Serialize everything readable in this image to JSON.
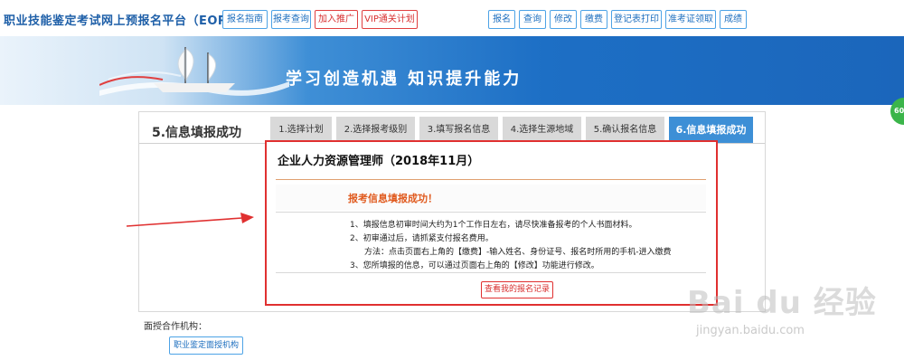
{
  "header": {
    "site_title": "职业技能鉴定考试网上预报名平台（EORS）",
    "left_nav": [
      "报名指南",
      "报考查询",
      "加入推广",
      "VIP通关计划"
    ],
    "right_nav": [
      "报名",
      "查询",
      "修改",
      "缴费",
      "登记表打印",
      "准考证领取",
      "成绩"
    ]
  },
  "banner": {
    "slogan": "学习创造机遇  知识提升能力"
  },
  "main": {
    "page_title": "5.信息填报成功",
    "steps": [
      "1.选择计划",
      "2.选择报考级别",
      "3.填写报名信息",
      "4.选择生源地域",
      "5.确认报名信息",
      "6.信息填报成功"
    ],
    "active_step": 5
  },
  "panel": {
    "cert_title": "企业人力资源管理师（2018年11月）",
    "success_message": "报考信息填报成功！",
    "notes": [
      "1、填报信息初审时间大约为1个工作日左右，请尽快准备报考的个人书面材料。",
      "2、初审通过后，请抓紧支付报名费用。",
      "方法：点击页面右上角的【缴费】-输入姓名、身份证号、报名时所用的手机-进入缴费",
      "3、您所填报的信息，可以通过页面右上角的【修改】功能进行修改。"
    ],
    "record_button": "查看我的报名记录"
  },
  "footer": {
    "partner_label": "面授合作机构：",
    "partner_button": "职业鉴定面授机构"
  },
  "watermark": {
    "logo": "Bai du 经验",
    "url": "jingyan.baidu.com"
  },
  "edge_badge": "60",
  "colors": {
    "accent_blue": "#3d8fd6",
    "highlight_red": "#e03030",
    "success_orange": "#e05a1e"
  },
  "icons": {
    "banner_art": "sailing-ship-icon",
    "annotation": "red-arrow-icon"
  }
}
